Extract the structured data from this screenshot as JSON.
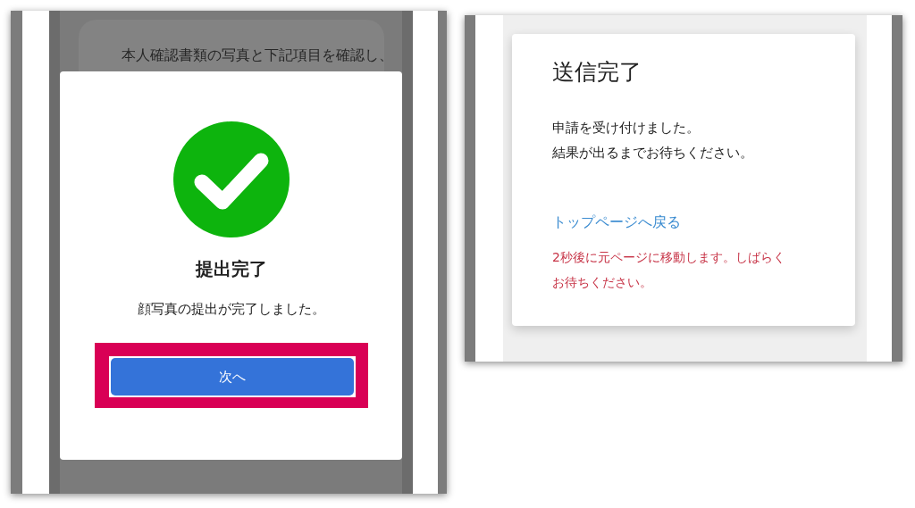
{
  "background_card": {
    "text": "本人確認書類の写真と下記項目を確認し、"
  },
  "modal": {
    "title": "提出完了",
    "message": "顔写真の提出が完了しました。",
    "button": "次へ",
    "highlighted": true
  },
  "completion_card": {
    "title": "送信完了",
    "lines": [
      "申請を受け付けました。",
      "結果が出るまでお待ちください。"
    ],
    "link": "トップページへ戻る",
    "notice": "2秒後に元ページに移動します。しばらくお待ちください。"
  }
}
